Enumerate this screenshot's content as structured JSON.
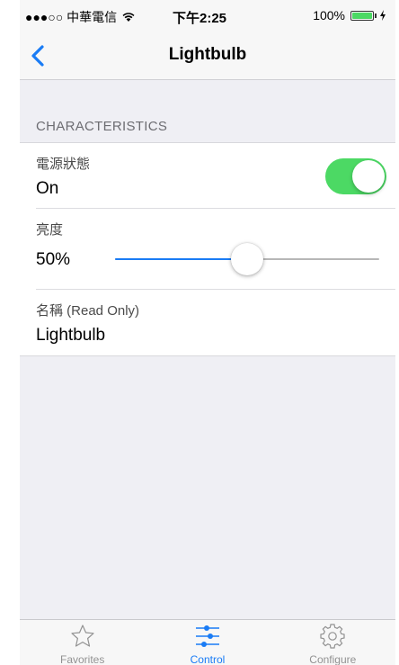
{
  "status_bar": {
    "carrier": "●●●○○ 中華電信",
    "wifi_icon": "wifi-icon",
    "time": "下午2:25",
    "battery_percent": "100%",
    "battery_icon": "battery-icon",
    "charging_icon": "charging-icon"
  },
  "nav": {
    "back_icon": "chevron-left-icon",
    "title": "Lightbulb"
  },
  "section": {
    "header": "CHARACTERISTICS"
  },
  "rows": {
    "power": {
      "label": "電源狀態",
      "value": "On",
      "toggle_on": true
    },
    "brightness": {
      "label": "亮度",
      "value": "50%",
      "level": 0.5
    },
    "name": {
      "label": "名稱 (Read Only)",
      "value": "Lightbulb"
    }
  },
  "tabs": [
    {
      "label": "Favorites",
      "icon": "star-icon",
      "active": false
    },
    {
      "label": "Control",
      "icon": "sliders-icon",
      "active": true
    },
    {
      "label": "Configure",
      "icon": "gear-icon",
      "active": false
    }
  ],
  "colors": {
    "accent": "#1a7cf5",
    "toggle_on": "#4cd964",
    "background": "#efeff4"
  }
}
